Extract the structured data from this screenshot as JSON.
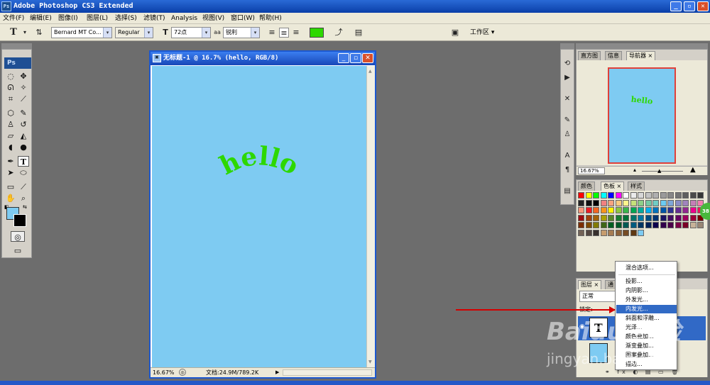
{
  "window": {
    "title": "Adobe Photoshop CS3 Extended",
    "app_badge": "Ps",
    "controls": [
      "_",
      "▫",
      "✕"
    ]
  },
  "menubar": [
    "文件(F)",
    "编辑(E)",
    "图像(I)",
    "图层(L)",
    "选择(S)",
    "滤镜(T)",
    "Analysis",
    "视图(V)",
    "窗口(W)",
    "帮助(H)"
  ],
  "options_bar": {
    "tool_glyph": "T",
    "font_family": "Bernard MT Co...",
    "font_style": "Regular",
    "font_size": "72点",
    "antialias_label": "aa",
    "antialias": "锐利",
    "text_color": "#2dd800",
    "workspace_label": "工作区"
  },
  "toolbox": {
    "logo": "Ps",
    "fg_color": "#7ecbf2",
    "bg_color": "#000000"
  },
  "document": {
    "title": "无标题-1 @ 16.7% (hello, RGB/8)",
    "canvas_color": "#7ecbf2",
    "text": "hello",
    "text_color": "#2dd800",
    "zoom": "16.67%",
    "doc_info": "文档:24.9M/789.2K"
  },
  "navigator_panel": {
    "tabs": [
      "直方图",
      "信息",
      "导航器"
    ],
    "preview_text": "hello",
    "zoom": "16.67%"
  },
  "swatches_panel": {
    "tabs": [
      "颜色",
      "色板",
      "样式"
    ],
    "colors": [
      "#ff0000",
      "#ffff00",
      "#00ff00",
      "#00ffff",
      "#0000ff",
      "#ff00ff",
      "#ffffff",
      "#ebebeb",
      "#d7d7d7",
      "#c3c3c3",
      "#afafaf",
      "#9b9b9b",
      "#878787",
      "#737373",
      "#5f5f5f",
      "#4b4b4b",
      "#373737",
      "#232323",
      "#0f0f0f",
      "#000000",
      "#f08080",
      "#f7a37f",
      "#fbca7f",
      "#fff58c",
      "#c5e17a",
      "#8dcf88",
      "#75c9a4",
      "#70cbc4",
      "#6ccbf2",
      "#7ea7d8",
      "#8a8dc5",
      "#a084bd",
      "#c47fb6",
      "#f27fb1",
      "#f7977a",
      "#ed1c24",
      "#f26522",
      "#f7941d",
      "#fff200",
      "#8dc63f",
      "#39b54a",
      "#00a651",
      "#00a99d",
      "#00aeef",
      "#0072bc",
      "#0054a6",
      "#2e3192",
      "#662d91",
      "#92278f",
      "#ec008c",
      "#ed145b",
      "#9e0b0f",
      "#a0410d",
      "#a36209",
      "#aba000",
      "#598527",
      "#1a7b30",
      "#007236",
      "#00746b",
      "#0076a3",
      "#004b80",
      "#003471",
      "#1b1464",
      "#440e62",
      "#630460",
      "#9e005d",
      "#9e0039",
      "#790000",
      "#7b2e00",
      "#7d4900",
      "#827b00",
      "#406618",
      "#005e20",
      "#005826",
      "#005952",
      "#005b7f",
      "#003663",
      "#002157",
      "#0d004c",
      "#32004b",
      "#4b0049",
      "#7b0046",
      "#7a0026",
      "#c7b299",
      "#998675",
      "#736357",
      "#534741",
      "#37302d",
      "#c69c6d",
      "#a67c52",
      "#8c6239",
      "#754c24",
      "#603913",
      "#7ecbf2"
    ]
  },
  "layers_panel": {
    "tabs": [
      "图层",
      "通"
    ],
    "blend_mode": "正常",
    "lock_label": "锁定:"
  },
  "context_menu": {
    "items": [
      "混合选项...",
      "投影...",
      "内阴影...",
      "外发光...",
      "内发光...",
      "斜面和浮雕...",
      "光泽...",
      "颜色叠加...",
      "渐变叠加...",
      "图案叠加...",
      "描边..."
    ],
    "highlighted": "内发光..."
  },
  "watermark": {
    "brand": "Baidu 经验",
    "url": "jingyan.baidu.com"
  },
  "badge": "38"
}
